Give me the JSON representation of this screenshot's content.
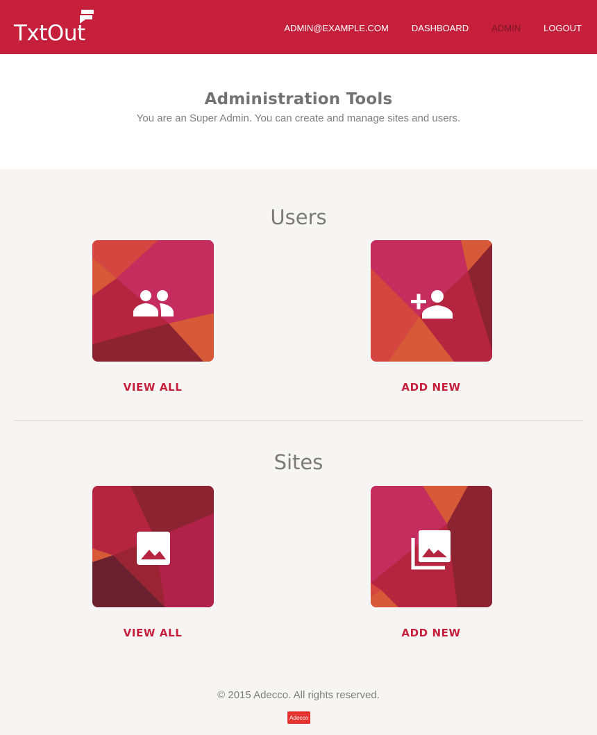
{
  "app": {
    "logo_text": "TxtOut"
  },
  "nav": {
    "email": "ADMIN@EXAMPLE.COM",
    "dashboard": "DASHBOARD",
    "admin": "ADMIN",
    "logout": "LOGOUT"
  },
  "hero": {
    "title": "Administration Tools",
    "subtitle": "You are an Super Admin. You can create and manage sites and users."
  },
  "users": {
    "title": "Users",
    "view_all": "VIEW ALL",
    "add_new": "ADD NEW",
    "view_all_icon": "group-icon",
    "add_new_icon": "person-add-icon"
  },
  "sites": {
    "title": "Sites",
    "view_all": "VIEW ALL",
    "add_new": "ADD NEW",
    "view_all_icon": "image-icon",
    "add_new_icon": "photo-library-icon"
  },
  "footer": {
    "copyright": "© 2015 Adecco. All rights reserved.",
    "brand": "Adecco"
  },
  "colors": {
    "brand": "#c51f3c",
    "active_nav": "#7a1528",
    "background": "#f7f5f4"
  }
}
